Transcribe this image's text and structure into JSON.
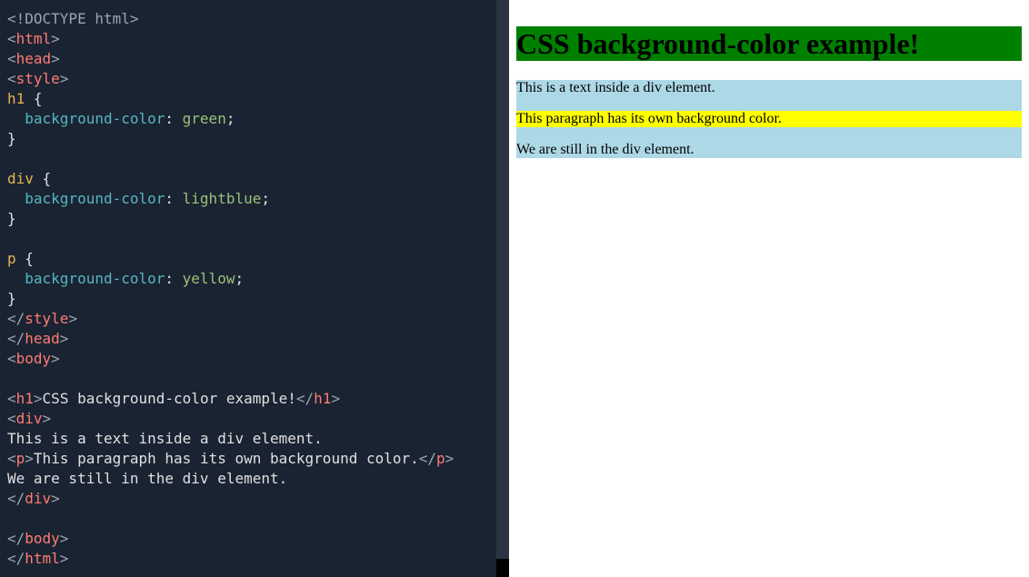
{
  "code": {
    "l1_doctype": "<!DOCTYPE html>",
    "l2_open": "<",
    "l2_tag": "html",
    "l2_close": ">",
    "l3_open": "<",
    "l3_tag": "head",
    "l3_close": ">",
    "l4_open": "<",
    "l4_tag": "style",
    "l4_close": ">",
    "l5_sel": "h1",
    "l5_brace": " {",
    "l6_indent": "  ",
    "l6_prop": "background-color",
    "l6_colon": ": ",
    "l6_val": "green",
    "l6_semi": ";",
    "l7_brace": "}",
    "l8_blank": "",
    "l9_sel": "div",
    "l9_brace": " {",
    "l10_indent": "  ",
    "l10_prop": "background-color",
    "l10_colon": ": ",
    "l10_val": "lightblue",
    "l10_semi": ";",
    "l11_brace": "}",
    "l12_blank": "",
    "l13_sel": "p",
    "l13_brace": " {",
    "l14_indent": "  ",
    "l14_prop": "background-color",
    "l14_colon": ": ",
    "l14_val": "yellow",
    "l14_semi": ";",
    "l15_brace": "}",
    "l16_open": "</",
    "l16_tag": "style",
    "l16_close": ">",
    "l17_open": "</",
    "l17_tag": "head",
    "l17_close": ">",
    "l18_open": "<",
    "l18_tag": "body",
    "l18_close": ">",
    "l19_blank": "",
    "l20_open": "<",
    "l20_tag": "h1",
    "l20_close": ">",
    "l20_text": "CSS background-color example!",
    "l20_open2": "</",
    "l20_tag2": "h1",
    "l20_close2": ">",
    "l21_open": "<",
    "l21_tag": "div",
    "l21_close": ">",
    "l22_text": "This is a text inside a div element.",
    "l23_open": "<",
    "l23_tag": "p",
    "l23_close": ">",
    "l23_text": "This paragraph has its own background color.",
    "l23_open2": "</",
    "l23_tag2": "p",
    "l23_close2": ">",
    "l24_text": "We are still in the div element.",
    "l25_open": "</",
    "l25_tag": "div",
    "l25_close": ">",
    "l26_blank": "",
    "l27_open": "</",
    "l27_tag": "body",
    "l27_close": ">",
    "l28_open": "</",
    "l28_tag": "html",
    "l28_close": ">"
  },
  "preview": {
    "heading": "CSS background-color example!",
    "div_text1": "This is a text inside a div element.",
    "paragraph": "This paragraph has its own background color.",
    "div_text2": "We are still in the div element."
  }
}
